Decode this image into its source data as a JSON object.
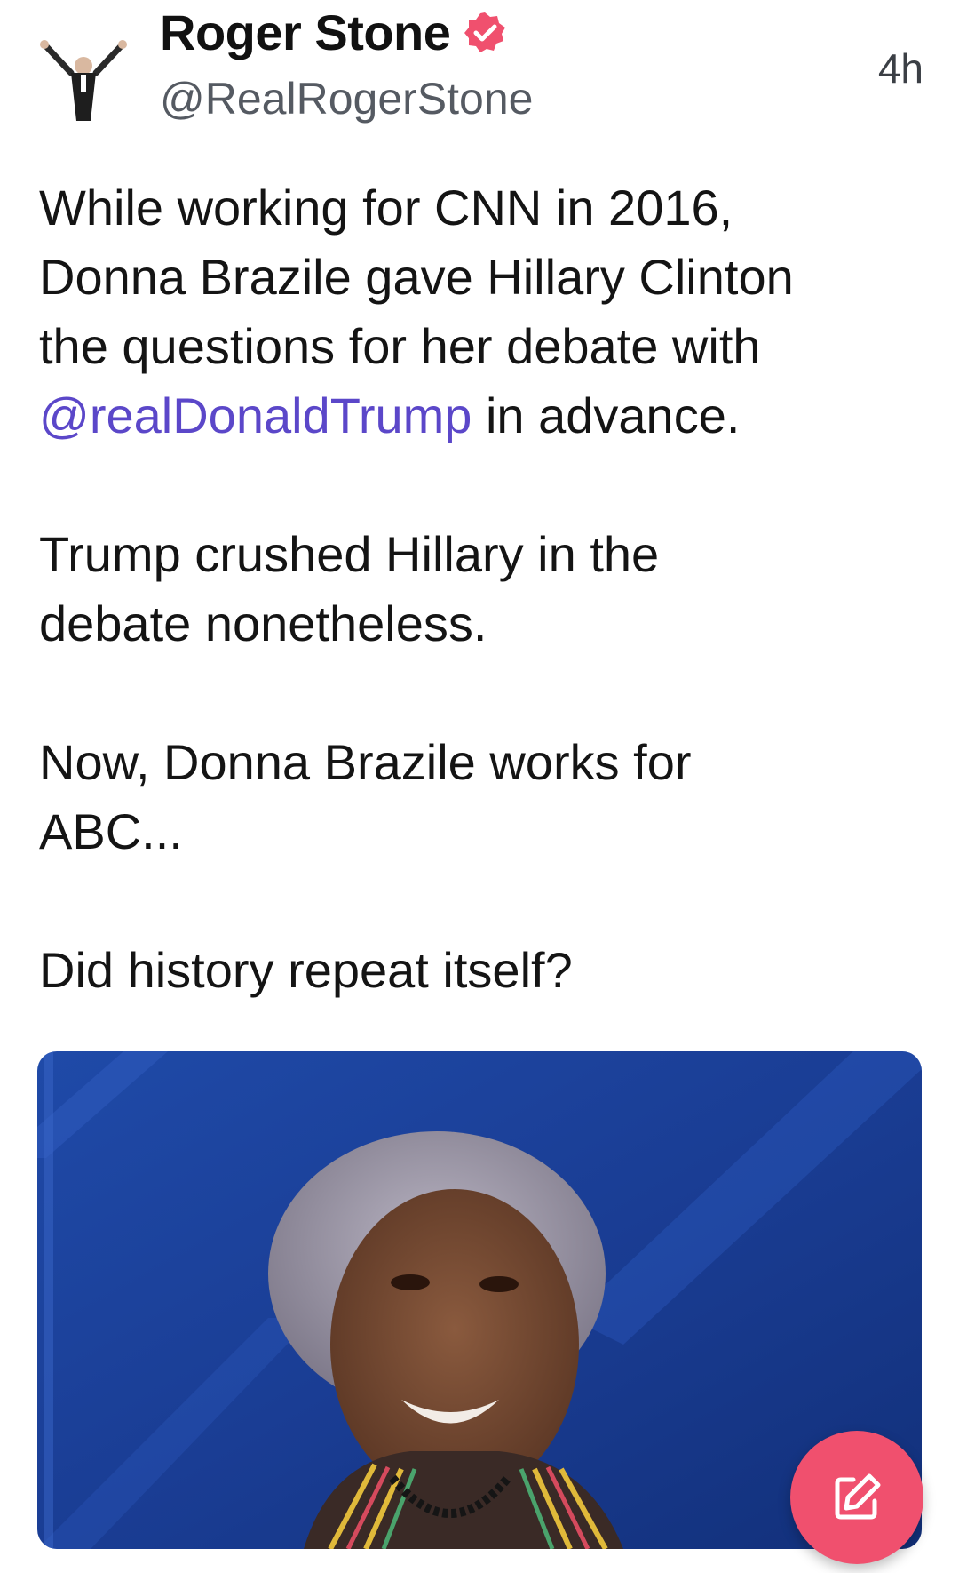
{
  "post": {
    "author_name": "Roger Stone",
    "author_handle": "@RealRogerStone",
    "timestamp": "4h",
    "verified": true,
    "paragraph_1_before": "While working for CNN in 2016,\nDonna Brazile gave Hillary Clinton\nthe questions for her debate with\n",
    "mention": "@realDonaldTrump",
    "paragraph_1_after": " in advance.",
    "paragraph_2": "Trump crushed Hillary in the\ndebate nonetheless.",
    "paragraph_3": "Now, Donna Brazile works for\nABC...",
    "paragraph_4": "Did history repeat itself?"
  },
  "colors": {
    "mention": "#5b47c9",
    "verified_badge": "#f0506e",
    "compose_button": "#f0506e"
  },
  "icons": {
    "verified": "verified-badge-icon",
    "compose": "compose-icon"
  }
}
